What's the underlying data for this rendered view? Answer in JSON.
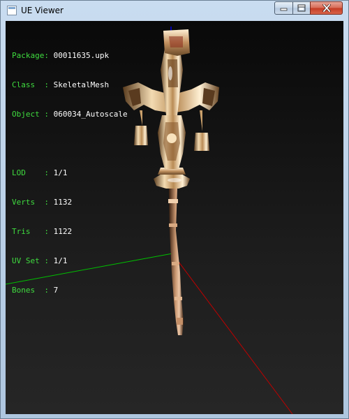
{
  "window": {
    "title": "UE Viewer"
  },
  "info": {
    "package_key": "Package: ",
    "package": "00011635.upk",
    "class_key": "Class  : ",
    "class": "SkeletalMesh",
    "object_key": "Object : ",
    "object": "060034_Autoscale",
    "lod_key": "LOD    : ",
    "lod": "1/1",
    "verts_key": "Verts  : ",
    "verts": "1132",
    "tris_key": "Tris   : ",
    "tris": "1122",
    "uvset_key": "UV Set : ",
    "uvset": "1/1",
    "bones_key": "Bones  : ",
    "bones": "7"
  },
  "colors": {
    "info_key": "#3fdc3f",
    "info_value": "#ffffff",
    "axis_x": "#c00000",
    "axis_y": "#00c000",
    "axis_z": "#0000e0",
    "mesh_gold": "#d9b27a"
  },
  "icons": {
    "app": "ue-viewer-icon",
    "minimize": "minimize-icon",
    "maximize": "maximize-icon",
    "close": "close-icon"
  }
}
